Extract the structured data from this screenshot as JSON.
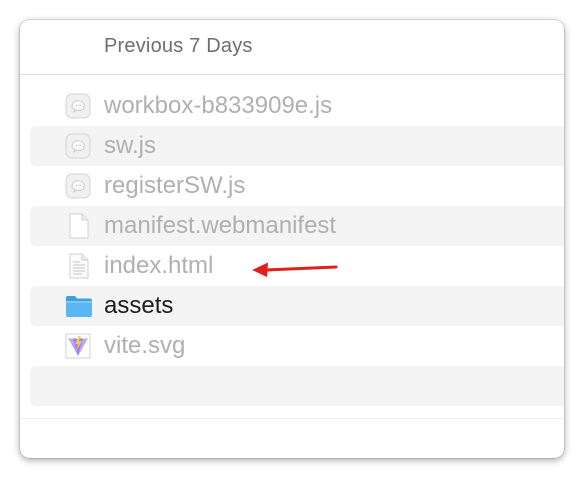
{
  "section": {
    "title": "Previous 7 Days"
  },
  "files": [
    {
      "name": "workbox-b833909e.js",
      "icon": "js-file-icon",
      "dimmed": true
    },
    {
      "name": "sw.js",
      "icon": "js-file-icon",
      "dimmed": true
    },
    {
      "name": "registerSW.js",
      "icon": "js-file-icon",
      "dimmed": true
    },
    {
      "name": "manifest.webmanifest",
      "icon": "generic-document-icon",
      "dimmed": true
    },
    {
      "name": "index.html",
      "icon": "html-document-icon",
      "dimmed": true
    },
    {
      "name": "assets",
      "icon": "folder-icon",
      "dimmed": false
    },
    {
      "name": "vite.svg",
      "icon": "vite-logo-icon",
      "dimmed": true
    }
  ],
  "colors": {
    "dimmed_text": "#b0b0b0",
    "active_text": "#1c1c1c",
    "folder_blue": "#4fb0ee",
    "annotation_arrow": "#e0201b",
    "stripe": "#f4f4f4"
  }
}
